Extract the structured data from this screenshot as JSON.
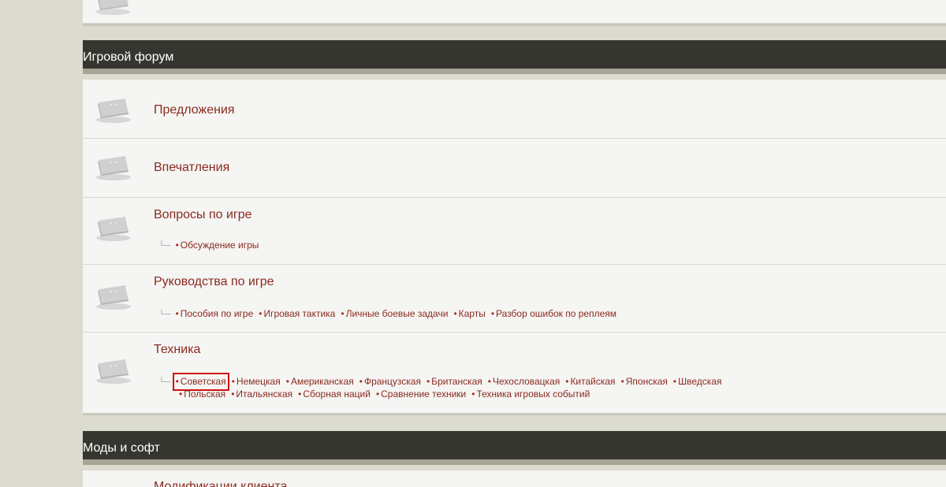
{
  "categories": [
    {
      "title": "Игровой форум",
      "forums": [
        {
          "title": "Предложения",
          "subforums": []
        },
        {
          "title": "Впечатления",
          "subforums": []
        },
        {
          "title": "Вопросы по игре",
          "subforums": [
            "Обсуждение игры"
          ]
        },
        {
          "title": "Руководства по игре",
          "subforums": [
            "Пособия по игре",
            "Игровая тактика",
            "Личные боевые задачи",
            "Карты",
            "Разбор ошибок по реплеям"
          ]
        },
        {
          "title": "Техника",
          "subforums_line1": [
            "Советская",
            "Немецкая",
            "Американская",
            "Французская",
            "Британская",
            "Чехословацкая",
            "Китайская",
            "Японская",
            "Шведская"
          ],
          "subforums_line2": [
            "Польская",
            "Итальянская",
            "Сборная наций",
            "Сравнение техники",
            "Техника игровых событий"
          ]
        }
      ]
    },
    {
      "title": "Моды и софт",
      "forums": [
        {
          "title": "Модификации клиента"
        }
      ]
    }
  ],
  "colors": {
    "header_bg": "#363630",
    "link": "#8a2a1f",
    "highlight_box": "#d01010",
    "page_bg": "#dcdbd0"
  }
}
